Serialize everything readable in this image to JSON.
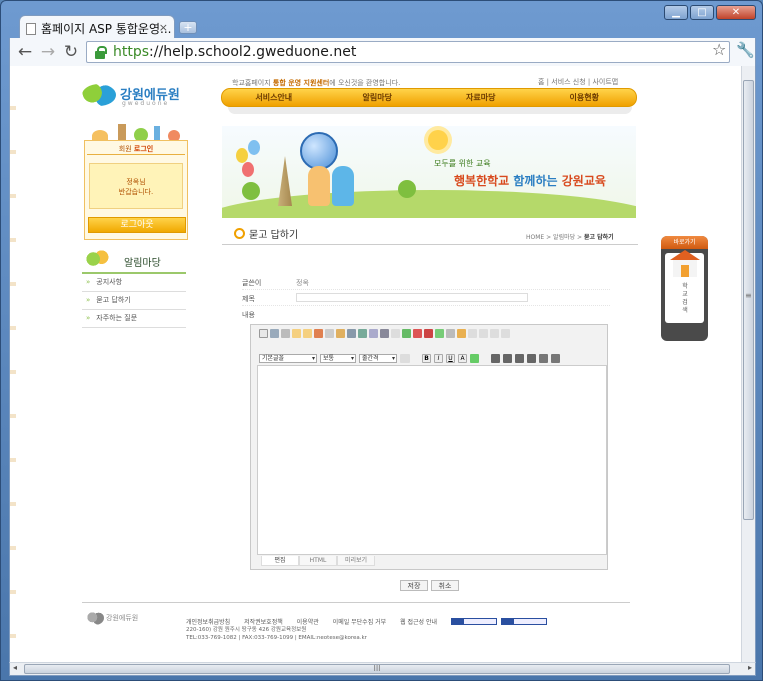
{
  "browser": {
    "tab_title": "홈페이지 ASP 통합운영...",
    "tab_close": "×",
    "new_tab": "+",
    "url_scheme": "https",
    "url_rest": "://help.school2.gweduone.net",
    "window_buttons": [
      "▁",
      "□",
      "✕"
    ],
    "back_icon": "←",
    "forward_icon": "→",
    "reload_icon": "↻",
    "star_icon": "☆",
    "wrench_icon": "🔧",
    "hscroll_grip": "III"
  },
  "site": {
    "logo_text": "강원에듀원",
    "logo_sub": "gweduone",
    "top_message_pre": "학교홈페이지 ",
    "top_message_bold": "통합 운영 지원센터",
    "top_message_post": "에 오신것을 환영합니다.",
    "top_links": "홈  |  서비스 신청  |  사이트맵",
    "menu": [
      "서비스안내",
      "알림마당",
      "자료마당",
      "이용현황"
    ],
    "banner_small": "모두를 위한 교육",
    "banner_big_1": "행복한학교 ",
    "banner_big_2": "함께하는",
    "banner_big_3": " 강원교육"
  },
  "login": {
    "header_pre": "회원 ",
    "header_bold": "로그인",
    "message_line1": "정옥님",
    "message_line2": "반갑습니다.",
    "logout_label": "로그아웃"
  },
  "sidebar": {
    "title": "알림마당",
    "items": [
      "공지사항",
      "묻고 답하기",
      "자주하는 질문"
    ]
  },
  "content": {
    "page_title": "묻고 답하기",
    "breadcrumb_home": "HOME",
    "breadcrumb_mid": "알림마당",
    "breadcrumb_current": "묻고 답하기",
    "author_label": "글쓴이",
    "author_value": "정옥",
    "subject_label": "제목",
    "content_label": "내용"
  },
  "editor": {
    "font_select": "기본글꼴",
    "size_select": "보통",
    "spacing_select": "줄간격",
    "format_buttons": [
      "B",
      "I",
      "U",
      "A"
    ],
    "tabs": [
      "편집",
      "HTML",
      "미리보기"
    ]
  },
  "actions": {
    "save": "저장",
    "cancel": "취소"
  },
  "quick_menu": {
    "header": "바로가기",
    "label": "학교검색"
  },
  "footer": {
    "logo_text": "강원에듀원",
    "links": [
      "개인정보취급방침",
      "저작권보호정책",
      "이용약관",
      "이메일 무단수집 거부",
      "웹 접근성 안내"
    ],
    "address": "220-160) 강원 원주시 땅구동 426 강원교육정보원",
    "contact": "TEL:033-769-1082 | FAX:033-769-1099 | EMAIL:neotese@korea.kr"
  }
}
